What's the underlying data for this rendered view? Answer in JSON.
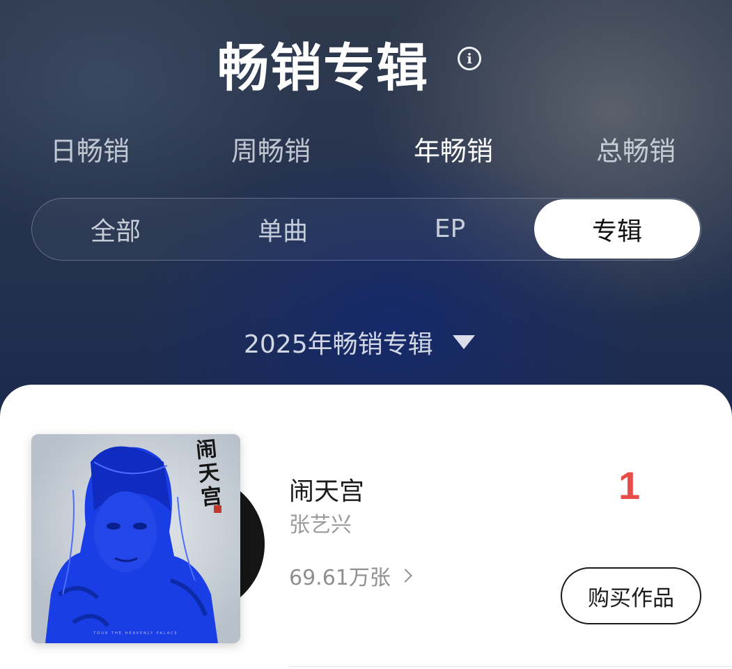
{
  "header": {
    "title": "畅销专辑"
  },
  "period_tabs": [
    {
      "label": "日畅销"
    },
    {
      "label": "周畅销"
    },
    {
      "label": "年畅销"
    },
    {
      "label": "总畅销"
    }
  ],
  "active_period": "年畅销",
  "type_tabs": [
    {
      "label": "全部"
    },
    {
      "label": "单曲"
    },
    {
      "label": "EP"
    },
    {
      "label": "专辑"
    }
  ],
  "active_type": "专辑",
  "year_selector": {
    "label": "2025年畅销专辑"
  },
  "items": [
    {
      "title": "闹天宫",
      "artist": "张艺兴",
      "sales": "69.61万张",
      "rank": "1",
      "buy_label": "购买作品",
      "cover_calligraphy": "闹天宫",
      "cover_caption": "TOUR THE HEAVENLY PALACE"
    }
  ],
  "colors": {
    "rank": "#e74c49",
    "cover_blue": "#1a3ee6",
    "background_top": "#2f3a4d",
    "background_bottom": "#122150"
  }
}
